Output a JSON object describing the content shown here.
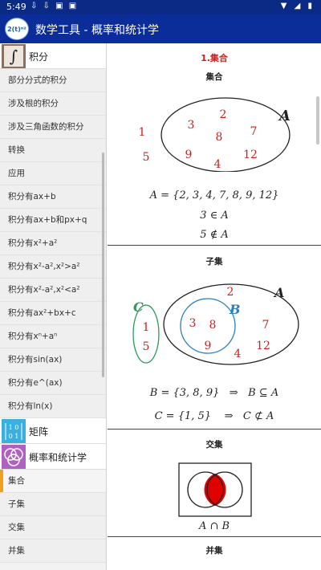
{
  "statusbar": {
    "time": "5:49",
    "notif_icons": "⇩ ⇩ ▣ ▣",
    "right_icons": "▼ ◢ ▮"
  },
  "appbar": {
    "logo_text": "2(t)ⁿ²",
    "title": "数学工具 - 概率和统计学"
  },
  "sidebar": {
    "cat_integral": "积分",
    "integral_items": [
      "部分分式的积分",
      "涉及根的积分",
      "涉及三角函数的积分",
      "转换",
      "应用",
      "积分有ax+b",
      "积分有ax+b和px+q",
      "积分有x²+a²",
      "积分有x²-a²,x²>a²",
      "积分有x²-a²,x²<a²",
      "积分有ax²+bx+c",
      "积分有xⁿ+aⁿ",
      "积分有sin(ax)",
      "积分有e^(ax)",
      "积分有ln(x)"
    ],
    "cat_matrix": "矩阵",
    "matrix_icon": {
      "r1": "1 0",
      "r2": "0 1"
    },
    "cat_prob": "概率和统计学",
    "prob_items": [
      "集合",
      "子集",
      "交集",
      "并集"
    ]
  },
  "content": {
    "heading": "1.集合",
    "set": {
      "title": "集合",
      "inside": [
        "2",
        "3",
        "7",
        "8",
        "9",
        "12",
        "4"
      ],
      "outside": [
        "1",
        "5"
      ],
      "label_A": "A",
      "eq1": "A = {2, 3, 4, 7, 8, 9, 12}",
      "eq2": "3 ∈ A",
      "eq3": "5 ∉ A"
    },
    "subset": {
      "title": "子集",
      "label_A": "A",
      "label_B": "B",
      "label_C": "C",
      "a_only": [
        "2",
        "7",
        "12",
        "4"
      ],
      "b_elems": [
        "3",
        "8",
        "9"
      ],
      "c_elems": [
        "1",
        "5"
      ],
      "eq1_left": "B = {3, 8, 9}",
      "eq1_arrow": "⇒",
      "eq1_right": "B ⊆ A",
      "eq2_left": "C = {1, 5}",
      "eq2_arrow": "⇒",
      "eq2_right": "C ⊄ A"
    },
    "intersection": {
      "title": "交集",
      "caption": "A ∩ B"
    },
    "union": {
      "title": "并集"
    }
  },
  "colors": {
    "appbar": "#0b2d9a",
    "statusbar": "#0a2a86",
    "accent_red": "#cc2020",
    "selected_marker": "#f0a020",
    "subset_B": "#2a7fc0",
    "subset_C": "#2a9a5a"
  }
}
